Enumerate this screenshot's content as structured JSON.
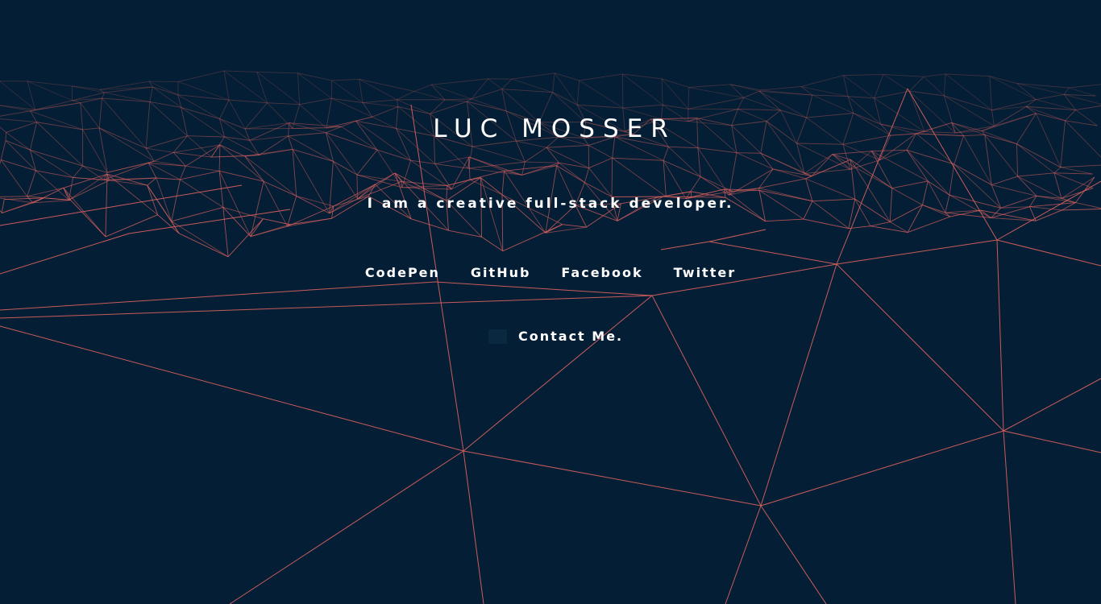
{
  "header": {
    "name": "LUC MOSSER",
    "tagline": "I am a creative full-stack developer."
  },
  "social_links": [
    {
      "label": "CodePen"
    },
    {
      "label": "GitHub"
    },
    {
      "label": "Facebook"
    },
    {
      "label": "Twitter"
    }
  ],
  "contact": {
    "label": "Contact Me."
  },
  "colors": {
    "background": "#041f35",
    "mesh_line": "#e0625f",
    "text": "#ffffff"
  }
}
